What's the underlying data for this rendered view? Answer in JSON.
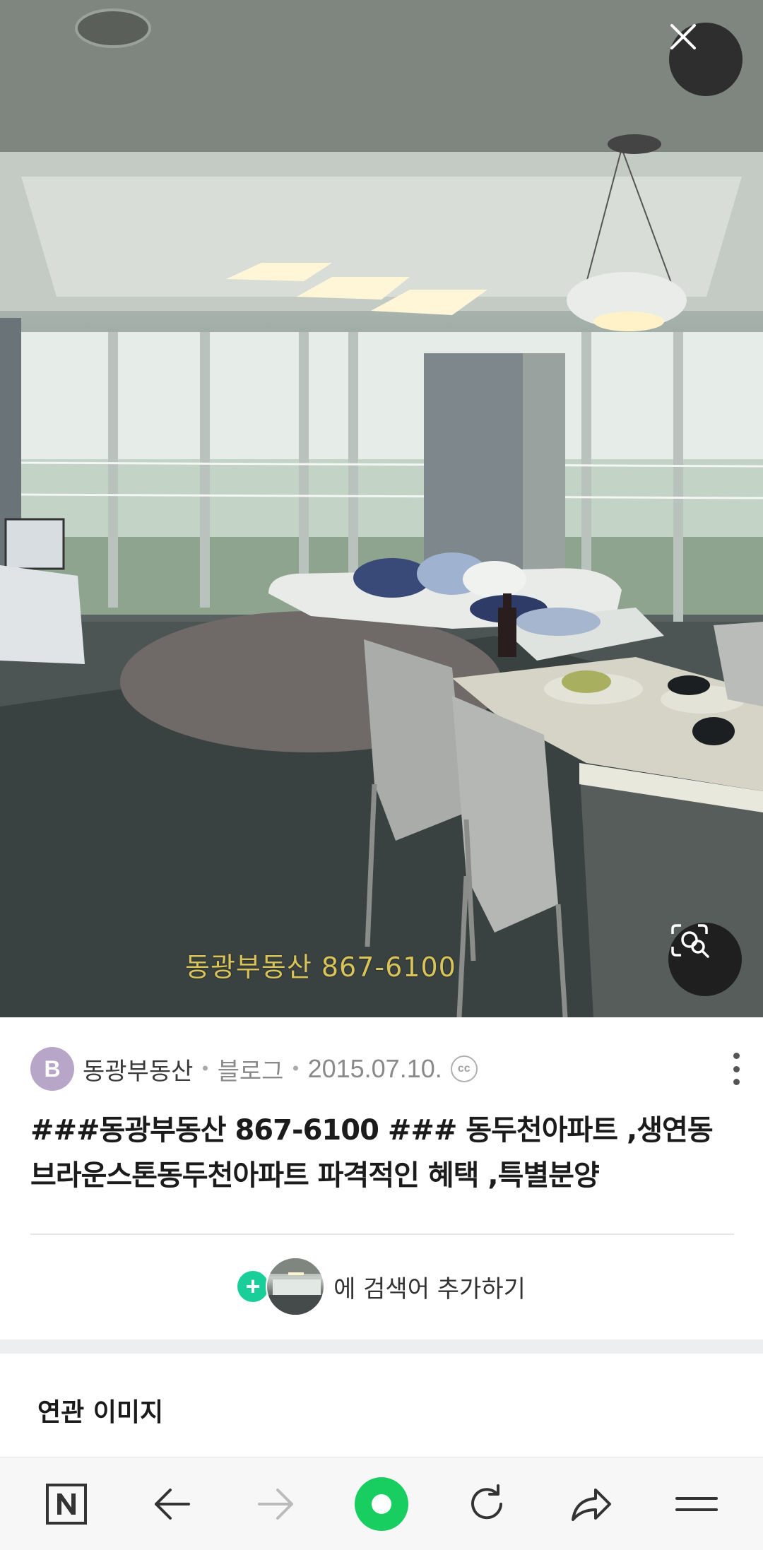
{
  "photo": {
    "watermark": "동광부동산 867-6100",
    "close_icon": "close-icon",
    "lens_icon": "image-search-icon"
  },
  "source": {
    "avatar_letter": "B",
    "name": "동광부동산",
    "type": "블로그",
    "date": "2015.07.10.",
    "license_badge": "cc"
  },
  "title": "###동광부동산 867-6100 ### 동두천아파트 ,생연동 브라운스톤동두천아파트 파격적인 혜택 ,특별분양",
  "add_search": {
    "label": "에 검색어 추가하기"
  },
  "related": {
    "title": "연관 이미지"
  },
  "colors": {
    "accent_green": "#19ce98",
    "avatar_purple": "#b7a6c8",
    "watermark_yellow": "#d9c45a"
  },
  "bottom_nav": [
    "naver-home-icon",
    "back-icon",
    "forward-icon",
    "green-dot-icon",
    "reload-icon",
    "share-icon",
    "menu-icon"
  ]
}
